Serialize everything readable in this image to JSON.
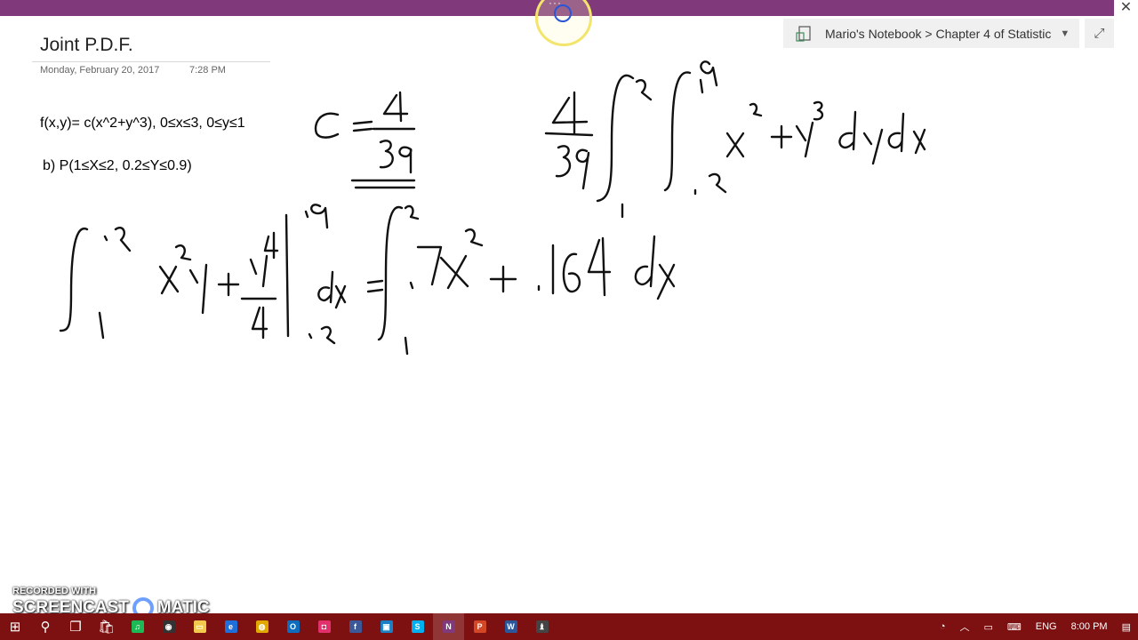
{
  "window": {
    "close_glyph": "✕",
    "menu_glyph": "···"
  },
  "breadcrumb": {
    "text": "Mario's Notebook > Chapter 4 of Statistic",
    "dropdown_glyph": "▼",
    "expand_glyph": "⤢",
    "icon": "notebook-icon"
  },
  "page": {
    "title": "Joint P.D.F.",
    "date": "Monday, February 20, 2017",
    "time": "7:28 PM",
    "line1": "f(x,y)= c(x^2+y^3), 0≤x≤3, 0≤y≤1",
    "line2": "b)   P(1≤X≤2, 0.2≤Y≤0.9)"
  },
  "watermark": {
    "top": "RECORDED WITH",
    "left": "SCREENCAST",
    "right": "MATIC"
  },
  "taskbar": {
    "apps": [
      {
        "name": "start",
        "label": "⊞"
      },
      {
        "name": "search",
        "label": "⚲"
      },
      {
        "name": "task-view",
        "label": "❐"
      },
      {
        "name": "store",
        "label": "🛍"
      },
      {
        "name": "spotify",
        "label": "♫",
        "color": "#1db954"
      },
      {
        "name": "media",
        "label": "◉",
        "color": "#333333"
      },
      {
        "name": "file-explorer",
        "label": "▭",
        "color": "#f2c94c"
      },
      {
        "name": "edge",
        "label": "e",
        "color": "#1e6fd9"
      },
      {
        "name": "chrome",
        "label": "◍",
        "color": "#e0a800"
      },
      {
        "name": "outlook",
        "label": "O",
        "color": "#0f6cbd"
      },
      {
        "name": "instagram",
        "label": "◘",
        "color": "#e1306c"
      },
      {
        "name": "facebook",
        "label": "f",
        "color": "#3b5998"
      },
      {
        "name": "app-blue",
        "label": "▣",
        "color": "#1a7fc4"
      },
      {
        "name": "skype",
        "label": "S",
        "color": "#00aff0"
      },
      {
        "name": "onenote",
        "label": "N",
        "color": "#80397b",
        "active": true
      },
      {
        "name": "powerpoint",
        "label": "P",
        "color": "#d24726"
      },
      {
        "name": "word",
        "label": "W",
        "color": "#2b579a"
      },
      {
        "name": "app-last",
        "label": "♝",
        "color": "#444444"
      }
    ],
    "tray": {
      "language": "ENG",
      "clock": "8:00 PM"
    }
  }
}
